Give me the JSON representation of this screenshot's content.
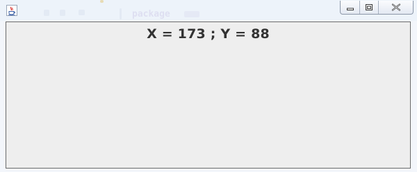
{
  "window": {
    "coordinate_readout": "X = 173 ; Y = 88"
  },
  "background": {
    "code_snippet": "package"
  },
  "icons": {
    "app": "java-app-icon",
    "minimize": "minimize-icon",
    "maximize": "maximize-icon",
    "close": "close-icon"
  }
}
